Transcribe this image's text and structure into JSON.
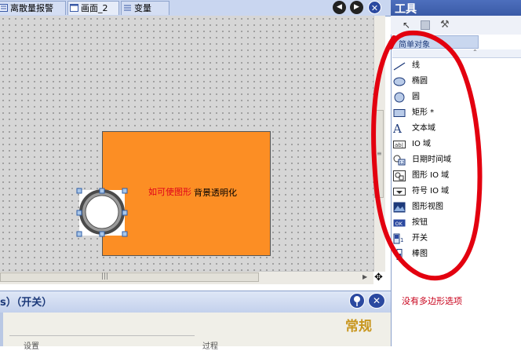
{
  "tabs": [
    {
      "label": "离散量报警"
    },
    {
      "label": "画面_2"
    },
    {
      "label": "变量"
    }
  ],
  "canvas": {
    "annotation_red": "如可使图形",
    "annotation_black": "背景透明化"
  },
  "lower_panel": {
    "title": "s）（开关）",
    "section": "常规",
    "col1": "设置",
    "col2": "过程"
  },
  "tools_panel": {
    "title": "工具",
    "group": "简单对象",
    "items": [
      {
        "label": "线",
        "icon": "line-icon"
      },
      {
        "label": "椭圆",
        "icon": "ellipse-icon"
      },
      {
        "label": "圆",
        "icon": "circle-icon"
      },
      {
        "label": "矩形 *",
        "icon": "rectangle-icon"
      },
      {
        "label": "文本域",
        "icon": "text-field-icon"
      },
      {
        "label": "IO 域",
        "icon": "io-field-icon"
      },
      {
        "label": "日期时间域",
        "icon": "date-time-icon"
      },
      {
        "label": "图形 IO 域",
        "icon": "graphic-io-icon"
      },
      {
        "label": "符号 IO 域",
        "icon": "symbolic-io-icon"
      },
      {
        "label": "图形视图",
        "icon": "graphic-view-icon"
      },
      {
        "label": "按钮",
        "icon": "button-icon"
      },
      {
        "label": "开关",
        "icon": "switch-icon"
      },
      {
        "label": "棒图",
        "icon": "bar-icon"
      }
    ],
    "note": "没有多边形选项"
  },
  "colors": {
    "orange": "#fc8e24",
    "annotation_red": "#e0001a",
    "header_blue": "#3a5aa6"
  }
}
